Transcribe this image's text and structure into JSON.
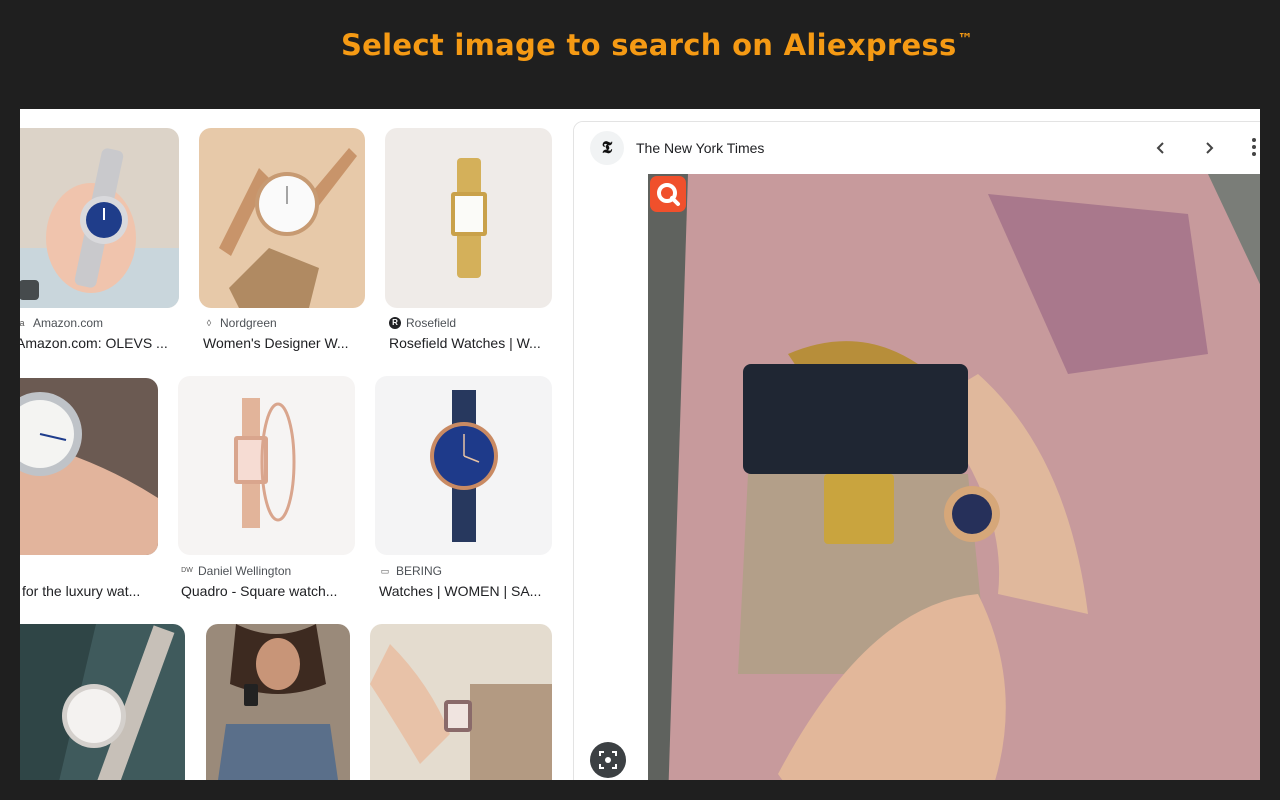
{
  "banner": {
    "title": "Select image to search on Aliexpress",
    "trademark": "™"
  },
  "results": [
    {
      "source": "Amazon.com",
      "source_icon": "amazon-icon",
      "caption": "Amazon.com: OLEVS ..."
    },
    {
      "source": "Nordgreen",
      "source_icon": "nordgreen-icon",
      "caption": "Women's Designer W..."
    },
    {
      "source": "Rosefield",
      "source_icon": "rosefield-icon",
      "caption": "Rosefield Watches | W..."
    },
    {
      "source": "",
      "source_icon": "",
      "caption": "for the luxury wat..."
    },
    {
      "source": "Daniel Wellington",
      "source_icon": "dw-icon",
      "caption": "Quadro - Square watch..."
    },
    {
      "source": "BERING",
      "source_icon": "bering-icon",
      "caption": "Watches | WOMEN | SA..."
    }
  ],
  "panel": {
    "site_name": "The New York Times",
    "logo_glyph": "𝕿"
  },
  "colors": {
    "banner_title": "#f59a14",
    "banner_bg": "#1f1f1f",
    "q_badge": "#f0502c"
  }
}
